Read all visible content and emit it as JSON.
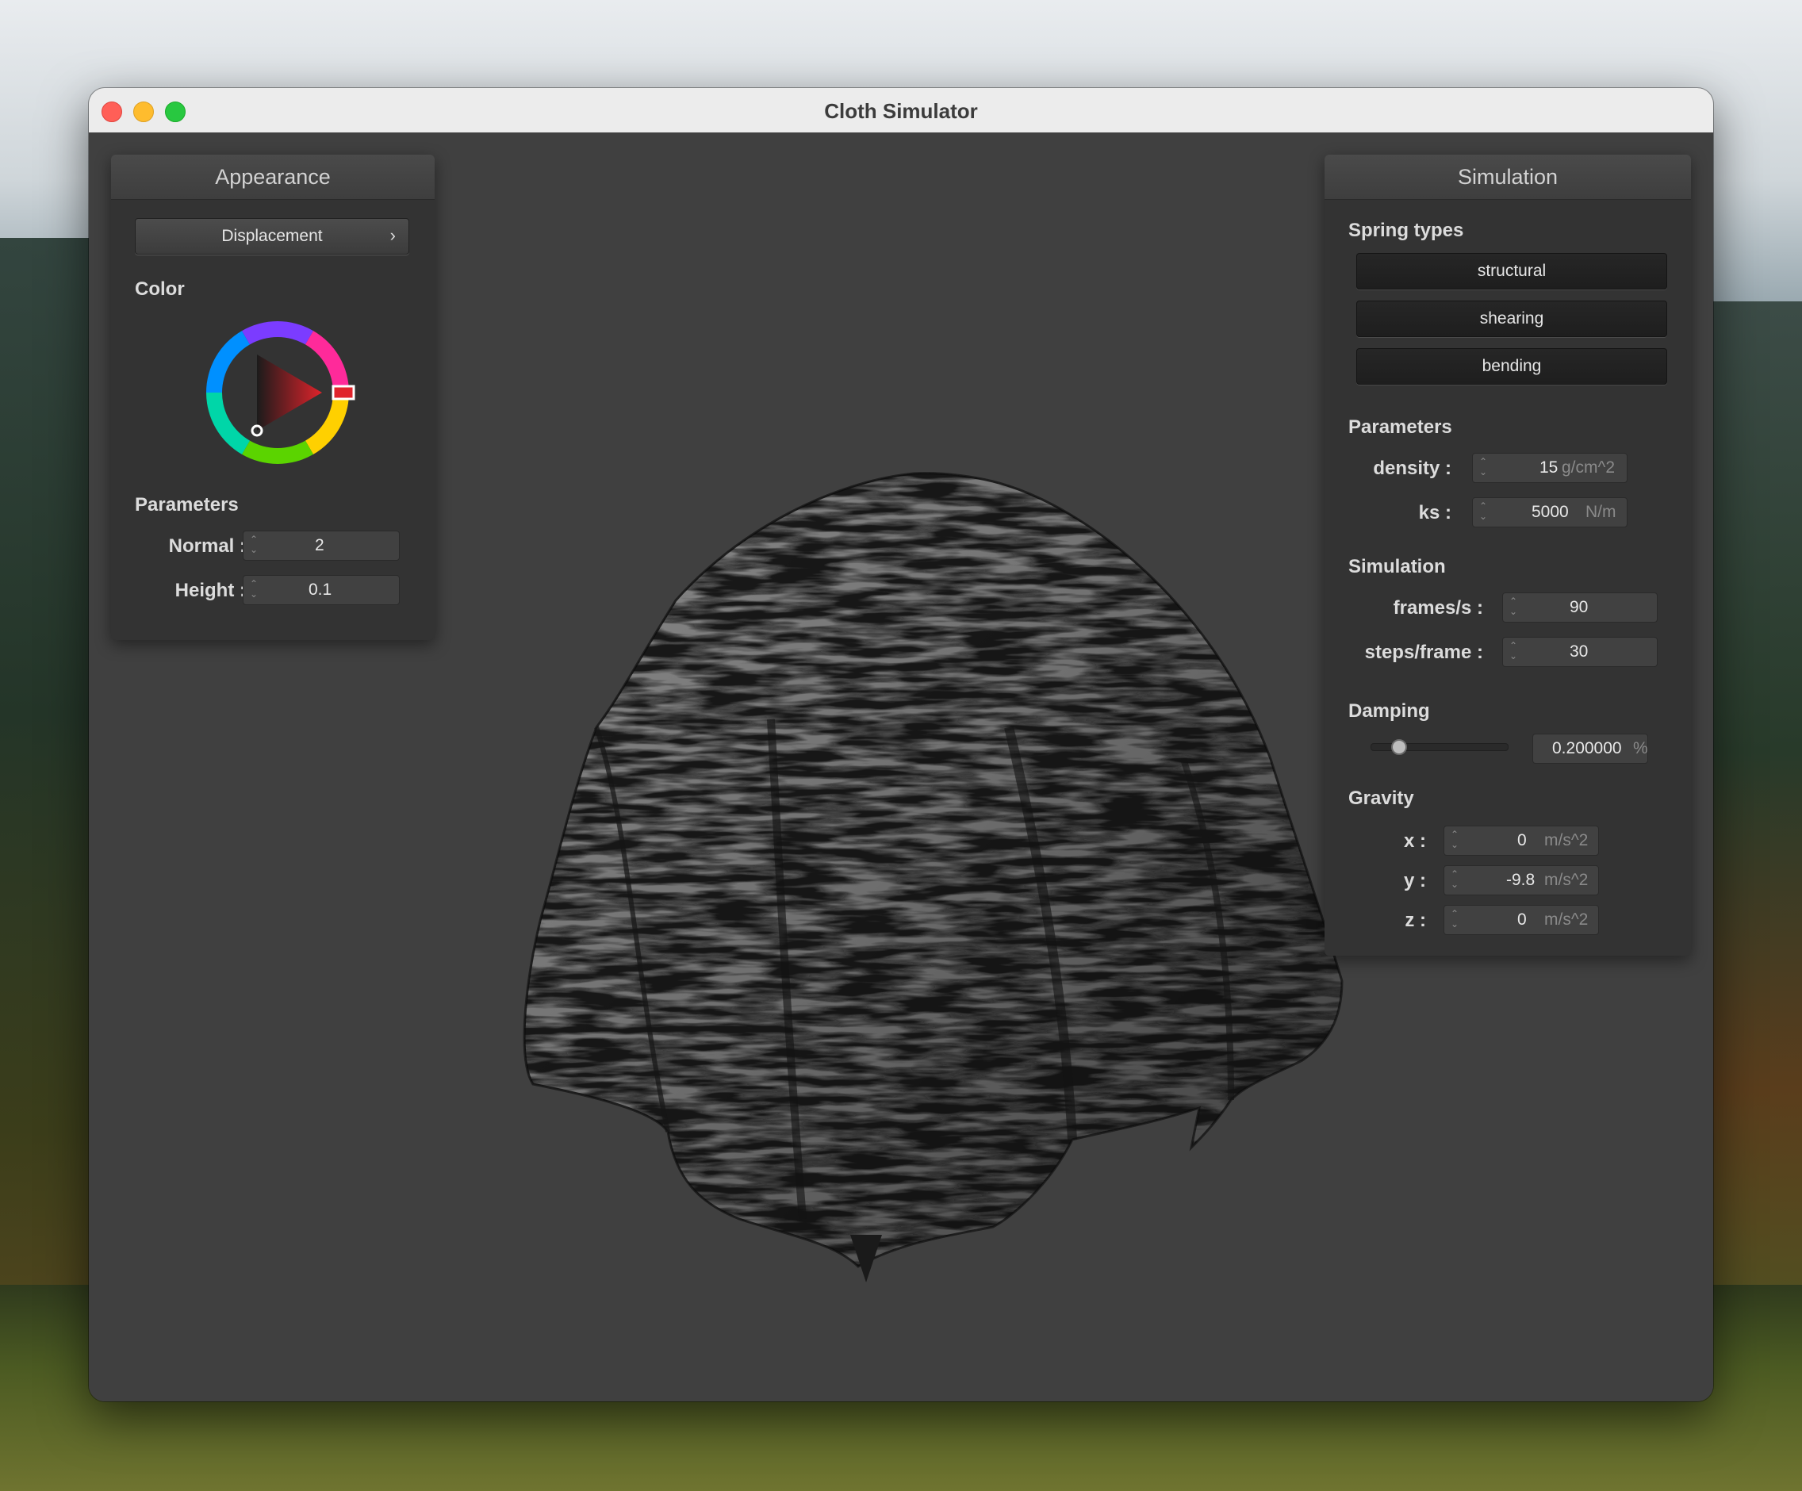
{
  "window": {
    "title": "Cloth Simulator"
  },
  "appearance": {
    "header": "Appearance",
    "shader_select": "Displacement",
    "color_section": "Color",
    "color_value": "#e0232b",
    "params_section": "Parameters",
    "normal": {
      "label": "Normal :",
      "value": "2"
    },
    "height": {
      "label": "Height :",
      "value": "0.1"
    }
  },
  "simulation_panel": {
    "header": "Simulation",
    "spring_section": "Spring types",
    "springs": [
      "structural",
      "shearing",
      "bending"
    ],
    "params_section": "Parameters",
    "density": {
      "label": "density :",
      "value": "15",
      "unit": "g/cm^2"
    },
    "ks": {
      "label": "ks :",
      "value": "5000",
      "unit": "N/m"
    },
    "sim_section": "Simulation",
    "fps": {
      "label": "frames/s :",
      "value": "90"
    },
    "steps": {
      "label": "steps/frame :",
      "value": "30"
    },
    "damping_section": "Damping",
    "damping": {
      "value": "0.200000",
      "unit": "%",
      "level": 0.2
    },
    "gravity_section": "Gravity",
    "gx": {
      "label": "x :",
      "value": "0",
      "unit": "m/s^2"
    },
    "gy": {
      "label": "y :",
      "value": "-9.8",
      "unit": "m/s^2"
    },
    "gz": {
      "label": "z :",
      "value": "0",
      "unit": "m/s^2"
    }
  }
}
